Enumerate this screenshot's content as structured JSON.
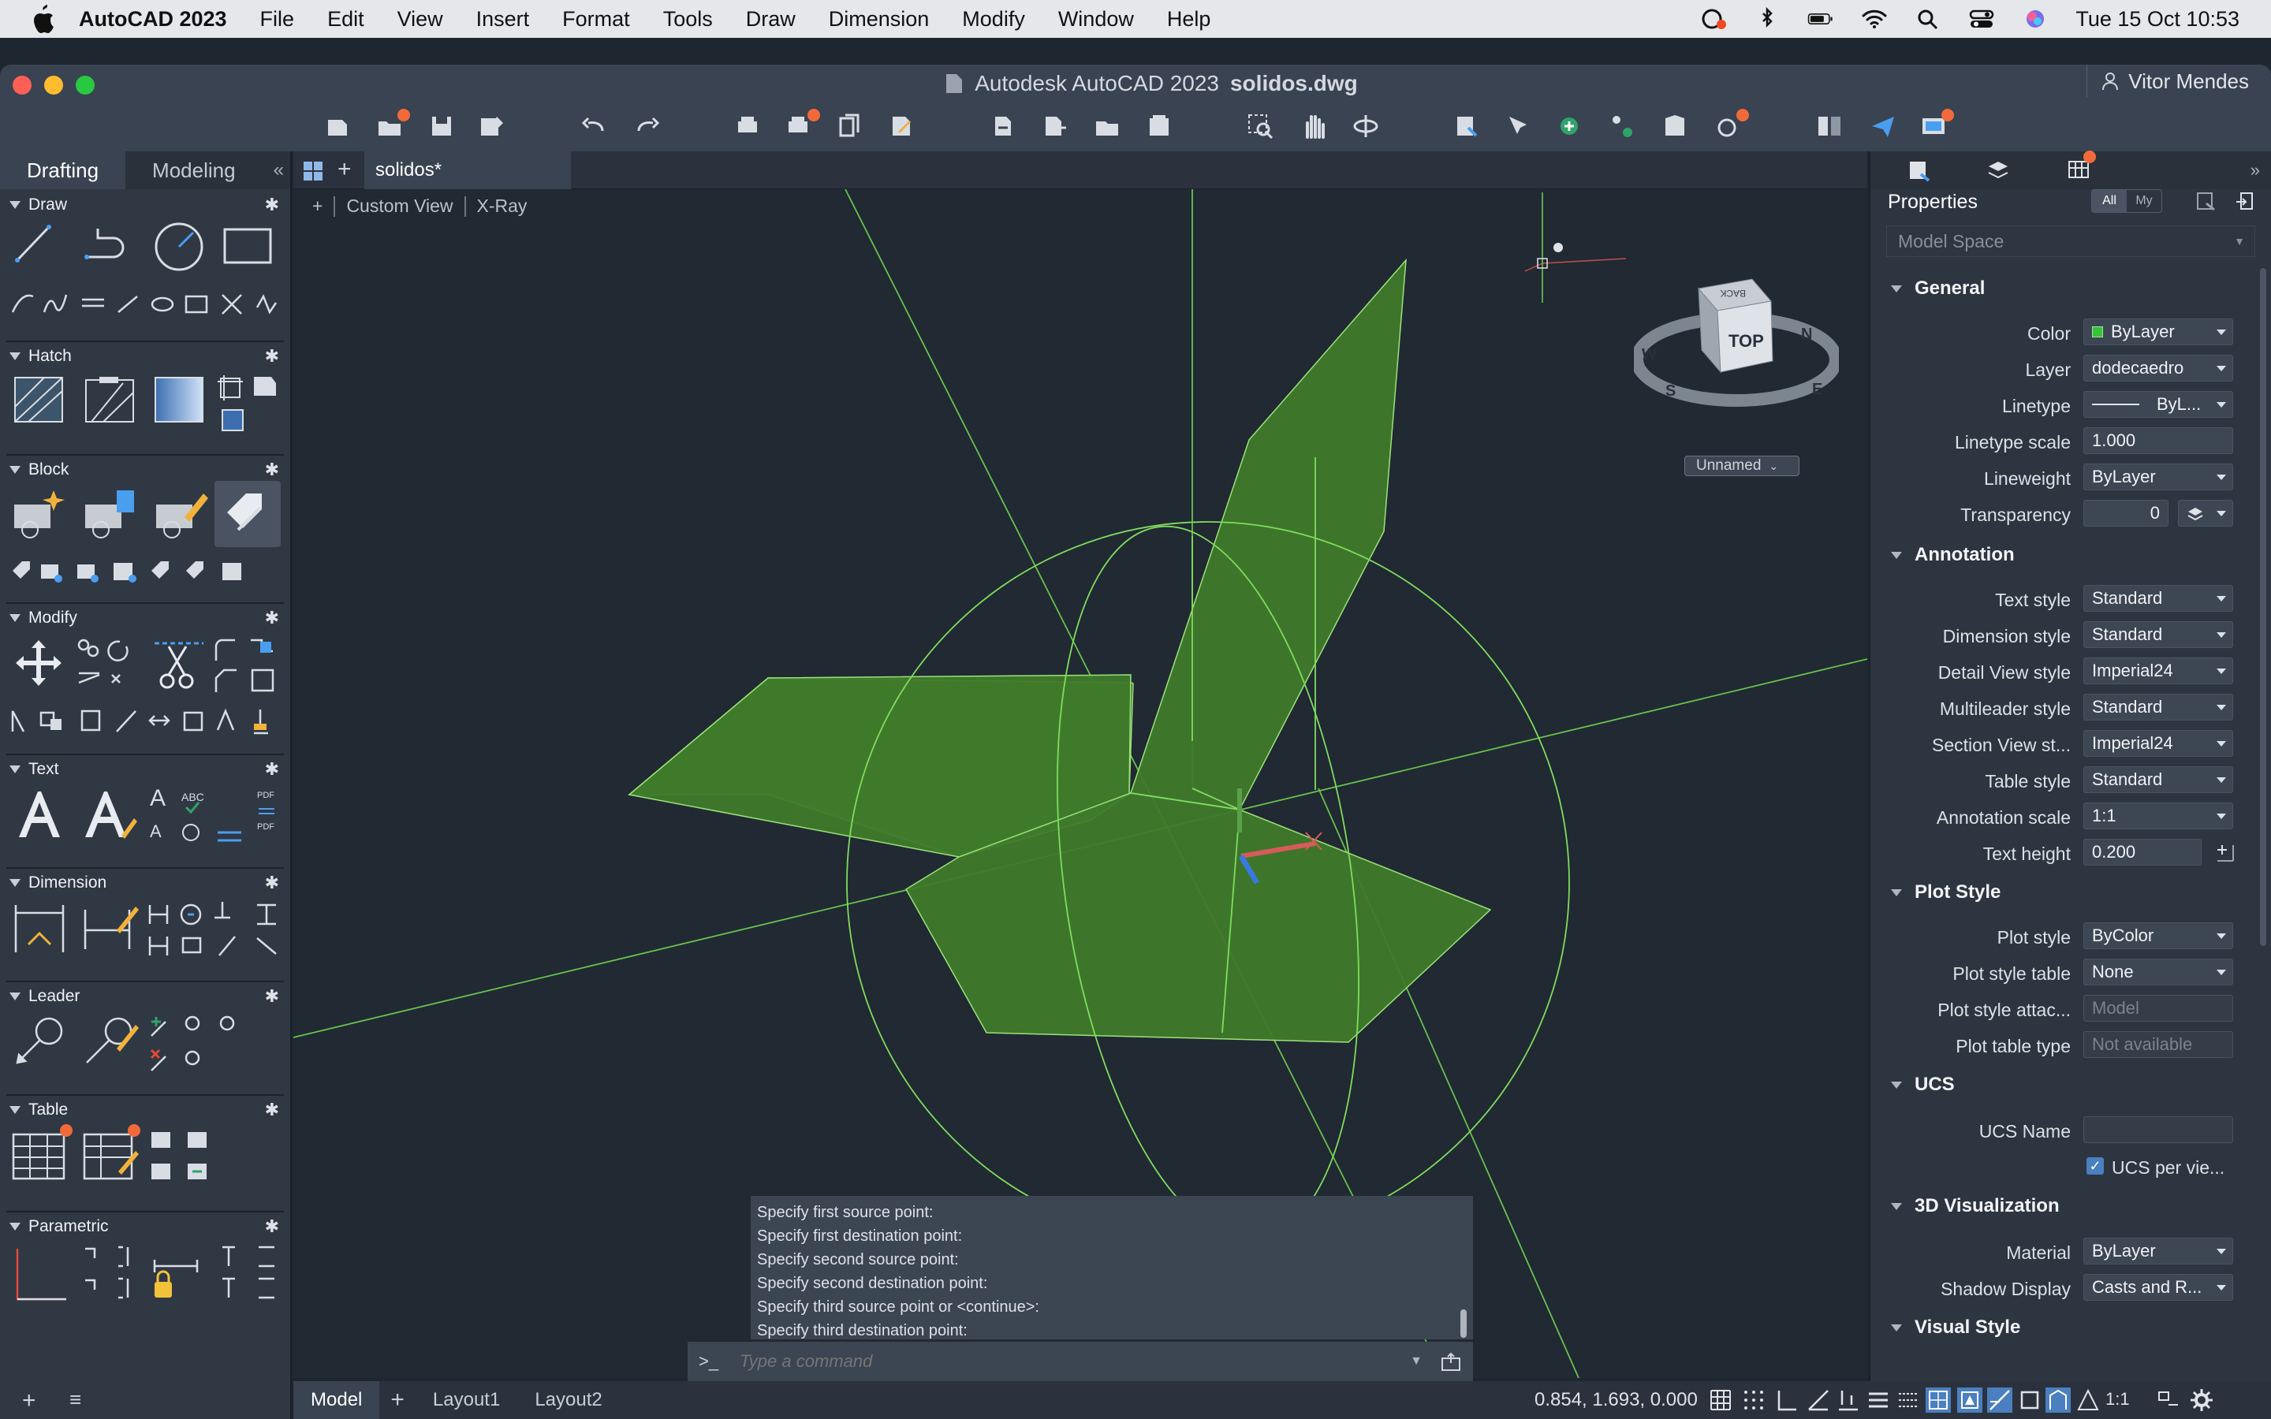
{
  "menubar": {
    "app_name": "AutoCAD 2023",
    "items": [
      "File",
      "Edit",
      "View",
      "Insert",
      "Format",
      "Tools",
      "Draw",
      "Dimension",
      "Modify",
      "Window",
      "Help"
    ],
    "datetime": "Tue 15 Oct  10:53"
  },
  "window": {
    "title_app": "Autodesk AutoCAD 2023",
    "title_file": "solidos.dwg",
    "user": "Vitor Mendes"
  },
  "left_panel": {
    "tabs": [
      "Drafting",
      "Modeling"
    ],
    "active_tab": "Drafting",
    "sections": [
      "Draw",
      "Hatch",
      "Block",
      "Modify",
      "Text",
      "Dimension",
      "Leader",
      "Table",
      "Parametric"
    ]
  },
  "document": {
    "tab": "solidos*",
    "view_label": "Custom View",
    "visual_style": "X-Ray",
    "viewport_plus": "+",
    "ucs_name": "Unnamed",
    "viewcube": {
      "face": "TOP",
      "back_label": "BACK",
      "compass": {
        "n": "N",
        "s": "S",
        "e": "E",
        "w": "W"
      }
    }
  },
  "command": {
    "history": [
      "Specify first source point:",
      "Specify first destination point:",
      "Specify second source point:",
      "Specify second destination point:",
      "Specify third source point or <continue>:",
      "Specify third destination point:"
    ],
    "prompt_symbol": ">_",
    "placeholder": "Type a command"
  },
  "statusbar": {
    "tabs": [
      "Model",
      "Layout1",
      "Layout2"
    ],
    "active_tab": "Model",
    "coordinates": "0.854, 1.693, 0.000",
    "annotation_scale": "1:1"
  },
  "properties": {
    "title": "Properties",
    "filter_all": "All",
    "filter_my": "My",
    "space": "Model Space",
    "groups": {
      "general": "General",
      "annotation": "Annotation",
      "plot_style": "Plot Style",
      "ucs": "UCS",
      "visualization": "3D Visualization",
      "visual_style": "Visual Style"
    },
    "general": [
      {
        "label": "Color",
        "value": "ByLayer"
      },
      {
        "label": "Layer",
        "value": "dodecaedro"
      },
      {
        "label": "Linetype",
        "value": "ByL..."
      },
      {
        "label": "Linetype scale",
        "value": "1.000"
      },
      {
        "label": "Lineweight",
        "value": "ByLayer"
      },
      {
        "label": "Transparency",
        "value": "0"
      }
    ],
    "annotation": [
      {
        "label": "Text style",
        "value": "Standard"
      },
      {
        "label": "Dimension style",
        "value": "Standard"
      },
      {
        "label": "Detail View style",
        "value": "Imperial24"
      },
      {
        "label": "Multileader style",
        "value": "Standard"
      },
      {
        "label": "Section View st...",
        "value": "Imperial24"
      },
      {
        "label": "Table style",
        "value": "Standard"
      },
      {
        "label": "Annotation scale",
        "value": "1:1"
      },
      {
        "label": "Text height",
        "value": "0.200"
      }
    ],
    "plot_style": [
      {
        "label": "Plot style",
        "value": "ByColor"
      },
      {
        "label": "Plot style table",
        "value": "None"
      },
      {
        "label": "Plot style attac...",
        "value": "Model"
      },
      {
        "label": "Plot table type",
        "value": "Not available"
      }
    ],
    "ucs": [
      {
        "label": "UCS Name",
        "value": ""
      },
      {
        "label": "UCS per vie...",
        "value": "checked"
      }
    ],
    "visualization": [
      {
        "label": "Material",
        "value": "ByLayer"
      },
      {
        "label": "Shadow Display",
        "value": "Casts and R..."
      }
    ]
  },
  "colors": {
    "solid_fill": "#3f7a2a",
    "wire": "#8be36a",
    "accent_dot": "#f26a3a"
  }
}
